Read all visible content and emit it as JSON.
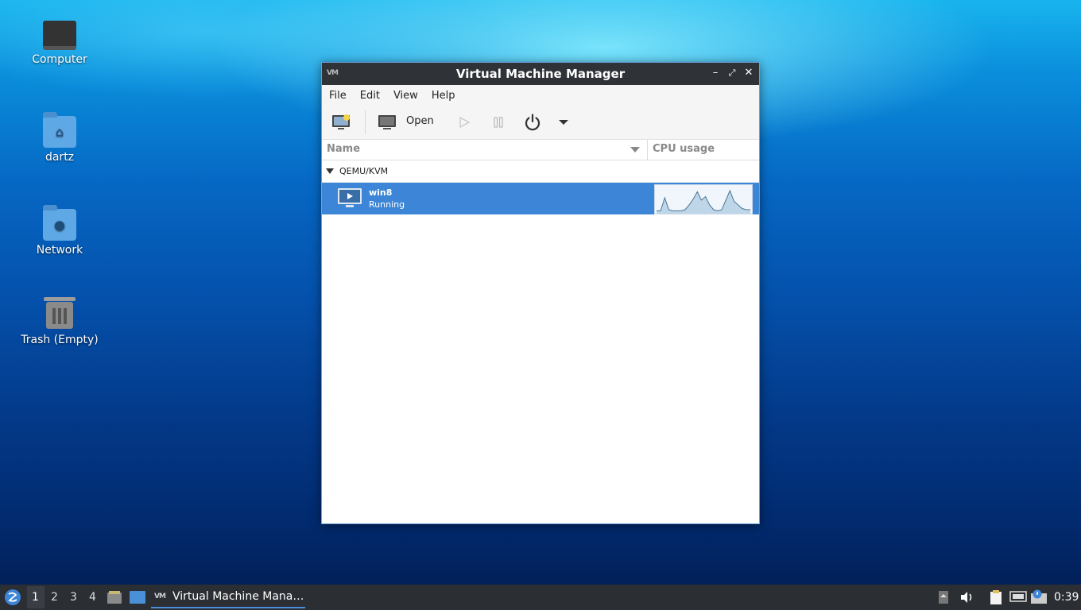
{
  "desktop": {
    "icons": [
      {
        "label": "Computer",
        "icon": "computer-icon"
      },
      {
        "label": "dartz",
        "icon": "home-folder-icon"
      },
      {
        "label": "Network",
        "icon": "network-folder-icon"
      },
      {
        "label": "Trash (Empty)",
        "icon": "trash-icon"
      }
    ]
  },
  "window": {
    "title": "Virtual Machine Manager",
    "menu": [
      "File",
      "Edit",
      "View",
      "Help"
    ],
    "toolbar": {
      "open_label": "Open"
    },
    "columns": {
      "name": "Name",
      "cpu": "CPU usage"
    },
    "group": "QEMU/KVM",
    "vms": [
      {
        "name": "win8",
        "status": "Running",
        "cpu_history": [
          0.05,
          0.05,
          0.6,
          0.1,
          0.05,
          0.05,
          0.05,
          0.1,
          0.3,
          0.55,
          0.85,
          0.5,
          0.65,
          0.3,
          0.1,
          0.05,
          0.1,
          0.5,
          0.9,
          0.45,
          0.3,
          0.15,
          0.1,
          0.1
        ]
      }
    ]
  },
  "taskbar": {
    "workspaces": [
      "1",
      "2",
      "3",
      "4"
    ],
    "active_workspace": "1",
    "task_label": "Virtual Machine Mana…",
    "clock": "0:39"
  },
  "colors": {
    "selection": "#3d85d6",
    "titlebar": "#2f3237",
    "taskbar": "#2b2e33"
  }
}
